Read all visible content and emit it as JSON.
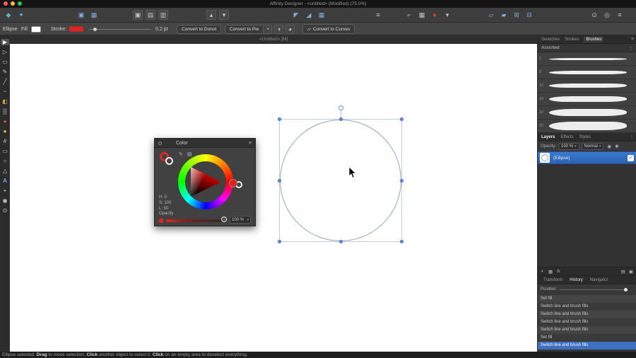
{
  "titlebar": {
    "title": "Affinity Designer - <untitled> (Modified) (75.0%)"
  },
  "toolbar": {
    "g1": [
      {
        "name": "draw-persona-icon",
        "glyph": "◆"
      },
      {
        "name": "export-persona-icon",
        "glyph": "✦"
      }
    ],
    "g2": [
      {
        "name": "place-image-icon",
        "glyph": "▣"
      },
      {
        "name": "picture-frame-icon",
        "glyph": "▦"
      }
    ],
    "g3": [
      {
        "name": "insert-inside-icon",
        "glyph": "▣"
      },
      {
        "name": "insert-on-top-icon",
        "glyph": "▤"
      },
      {
        "name": "insert-behind-icon",
        "glyph": "▥"
      }
    ],
    "g4": [
      {
        "name": "order-forward-icon",
        "glyph": "▴"
      },
      {
        "name": "order-back-icon",
        "glyph": "▾"
      }
    ],
    "g5": [
      {
        "name": "align-left-icon",
        "glyph": "◤"
      },
      {
        "name": "align-center-icon",
        "glyph": "◢"
      },
      {
        "name": "distribute-icon",
        "glyph": "▦"
      }
    ],
    "g6": [
      {
        "name": "text-justify-icon",
        "glyph": "≡"
      }
    ],
    "g7": [
      {
        "name": "corner-tool-icon",
        "glyph": "⌐"
      },
      {
        "name": "grid-options-icon",
        "glyph": "▦"
      },
      {
        "name": "snapping-icon",
        "glyph": "●"
      },
      {
        "name": "snapping-caret-icon",
        "glyph": "▾"
      }
    ],
    "g8": [
      {
        "name": "transform-flip-h-icon",
        "glyph": "▱"
      },
      {
        "name": "transform-flip-v-icon",
        "glyph": "▰"
      },
      {
        "name": "transform-rotate-icon",
        "glyph": "⊞"
      },
      {
        "name": "transform-shear-icon",
        "glyph": "⊟"
      }
    ],
    "g9": [
      {
        "name": "zoom-view-icon",
        "glyph": "⊙"
      },
      {
        "name": "view-mode-icon",
        "glyph": "◎"
      },
      {
        "name": "window-menu-icon",
        "glyph": "≡"
      }
    ]
  },
  "context": {
    "tool_label": "Ellipse",
    "fill_label": "Fill",
    "stroke_label": "Stroke:",
    "stroke_width": "0.2 pt",
    "convert_donut": "Convert to Donut",
    "convert_pie": "Convert to Pie",
    "convert_curves": "Convert to Curves",
    "curves_icon": "▱",
    "mode_icons": [
      {
        "name": "pie-mode-icon",
        "glyph": "◔"
      },
      {
        "name": "donut-mode-icon",
        "glyph": "◑"
      },
      {
        "name": "segment-mode-icon",
        "glyph": "◕"
      }
    ]
  },
  "doc_tab": {
    "label": "<Untitled> [M]"
  },
  "left_tools": [
    {
      "name": "move-tool",
      "glyph": "▶"
    },
    {
      "name": "node-tool",
      "glyph": "▷"
    },
    {
      "name": "box-select-tool",
      "glyph": "▭"
    },
    {
      "name": "pen-tool",
      "glyph": "✎"
    },
    {
      "name": "pencil-tool",
      "glyph": "╱"
    },
    {
      "name": "vector-brush-tool",
      "glyph": "~"
    },
    {
      "name": "fill-tool",
      "glyph": "◧"
    },
    {
      "name": "transparency-tool",
      "glyph": "▒"
    },
    {
      "name": "swatch-red",
      "glyph": "●"
    },
    {
      "name": "swatch-yellow",
      "glyph": "●"
    },
    {
      "name": "corner-tool",
      "glyph": "#"
    },
    {
      "name": "rectangle-tool",
      "glyph": "▭"
    },
    {
      "name": "ellipse-tool",
      "glyph": "○"
    },
    {
      "name": "polygon-tool",
      "glyph": "△"
    },
    {
      "name": "text-tool",
      "glyph": "A"
    },
    {
      "name": "color-picker-tool",
      "glyph": "+"
    },
    {
      "name": "view-tool",
      "glyph": "◉"
    },
    {
      "name": "zoom-tool",
      "glyph": "⊙"
    }
  ],
  "color_panel": {
    "title": "Color",
    "menu_icon": "≡",
    "pencil_icon": "✎",
    "grid_icon": "▤",
    "h": "H: 0",
    "s": "S: 100",
    "l": "L: 50",
    "opacity_label": "Opacity",
    "opacity_value": "100 %"
  },
  "brushes_panel": {
    "tabs": [
      "Swatches",
      "Strokes",
      "Brushes"
    ],
    "active_tab": "Brushes",
    "category": "Assorted",
    "brushes": [
      {
        "size": "6"
      },
      {
        "size": "8"
      },
      {
        "size": "12"
      },
      {
        "size": "16"
      },
      {
        "size": "22"
      },
      {
        "size": "32"
      }
    ]
  },
  "layers_panel": {
    "tabs": [
      "Layers",
      "Effects",
      "Styles"
    ],
    "opacity_label": "Opacity:",
    "opacity_value": "100 %",
    "blend_mode": "Normal",
    "layer": {
      "name": "(Ellipse)"
    }
  },
  "bottom_panel": {
    "left_icons": [
      {
        "name": "color-wheel-icon",
        "glyph": "◐"
      },
      {
        "name": "swatches-icon",
        "glyph": "▦"
      },
      {
        "name": "fx-icon",
        "glyph": "fx"
      }
    ],
    "right_icons": [
      {
        "name": "snapshot-icon",
        "glyph": "▤"
      },
      {
        "name": "export-page-icon",
        "glyph": "▣"
      }
    ],
    "tabs": [
      "Transform",
      "History",
      "Navigator"
    ],
    "active_tab": "History",
    "position_label": "Position:",
    "entries": [
      "Set fill",
      "Switch line and brush fills",
      "Switch line and brush fills",
      "Switch line and brush fills",
      "Switch line and brush fills",
      "Set fill",
      "Switch line and brush fills"
    ],
    "selected_index": 6
  },
  "status": {
    "parts": [
      "Ellipse selected. ",
      "Drag",
      " to move selection. ",
      "Click",
      " another object to select it. ",
      "Click",
      " on an empty area to deselect everything."
    ]
  },
  "ui": {
    "caret": "▾",
    "dots": "⋮",
    "menu": "≡",
    "check": "✓"
  },
  "colors": {
    "accent_blue": "#3f74c9",
    "stroke_red": "#e02222",
    "selection_handle": "#6b93dc"
  }
}
